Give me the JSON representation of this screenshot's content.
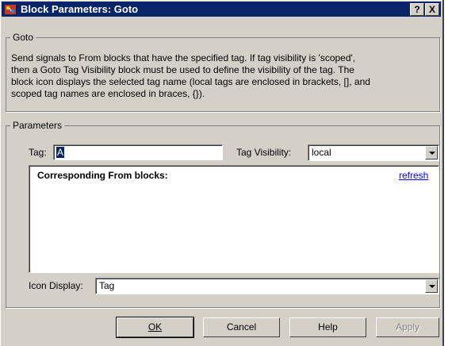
{
  "window": {
    "title": "Block Parameters: Goto",
    "help_button": "?",
    "close_button": "X"
  },
  "goto_group": {
    "legend": "Goto",
    "description_lines": [
      "Send signals to From blocks that have the specified tag.  If tag visibility is 'scoped',",
      "then a Goto Tag Visibility block must be used to define the visibility of the tag.  The",
      "block icon displays the selected tag name (local tags are enclosed in brackets, [], and",
      "scoped tag names are enclosed in braces, {})."
    ]
  },
  "parameters_group": {
    "legend": "Parameters",
    "tag_label": "Tag:",
    "tag_value": "A",
    "visibility_label": "Tag Visibility:",
    "visibility_value": "local",
    "from_blocks_header": "Corresponding From blocks:",
    "refresh_link": "refresh",
    "icon_display_label": "Icon Display:",
    "icon_display_value": "Tag"
  },
  "buttons": {
    "ok": "OK",
    "cancel": "Cancel",
    "help": "Help",
    "apply": "Apply"
  },
  "colors": {
    "title_bar": "#0a246a",
    "face": "#d4d0c8",
    "link": "#0000ee"
  }
}
